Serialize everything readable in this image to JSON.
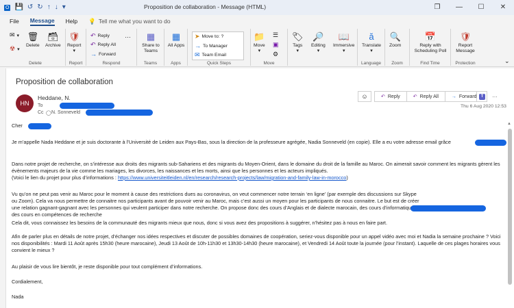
{
  "window": {
    "title": "Proposition de collaboration  -  Message (HTML)",
    "controls": [
      "restore-icon",
      "minimize-icon",
      "maximize-icon",
      "close-icon"
    ]
  },
  "menu": {
    "file": "File",
    "message": "Message",
    "help": "Help",
    "tell_me": "Tell me what you want to do"
  },
  "ribbon": {
    "delete_group": {
      "label": "Delete",
      "delete": "Delete",
      "archive": "Archive"
    },
    "report_group": {
      "label": "Report",
      "report": "Report"
    },
    "respond_group": {
      "label": "Respond",
      "reply": "Reply",
      "reply_all": "Reply All",
      "forward": "Forward"
    },
    "teams_group": {
      "label": "Teams",
      "share": "Share to Teams"
    },
    "apps_group": {
      "label": "Apps",
      "all_apps": "All Apps"
    },
    "quick_steps": {
      "label": "Quick Steps",
      "items": [
        "Move to: ?",
        "To Manager",
        "Team Email"
      ]
    },
    "move_group": {
      "label": "Move",
      "move": "Move"
    },
    "tags": {
      "tags": "Tags",
      "editing": "Editing",
      "immersive": "Immersive"
    },
    "language_group": {
      "label": "Language",
      "translate": "Translate"
    },
    "zoom_group": {
      "label": "Zoom",
      "zoom": "Zoom"
    },
    "find_time_group": {
      "label": "Find Time",
      "reply_poll": "Reply with Scheduling Poll"
    },
    "protection_group": {
      "label": "Protection",
      "report_message": "Report Message"
    }
  },
  "message": {
    "subject": "Proposition de collaboration",
    "avatar_initials": "HN",
    "sender": "Heddane, N.",
    "to_label": "To",
    "cc_label": "Cc",
    "cc_name": "N. Sonneveld",
    "date": "Thu 6 Aug 2020 12:53",
    "actions": {
      "reply": "Reply",
      "reply_all": "Reply All",
      "forward": "Forward"
    },
    "body": {
      "greeting": "Cher",
      "p1": "Je m’appelle Nada Heddane et je suis doctorante à l’Université de Leiden aux Pays-Bas, sous la direction de la professeure agrégée, Nadia Sonneveld (en copie). Elle a eu votre adresse email grâce",
      "p2": "Dans notre projet de recherche, on s’intéresse aux droits des migrants sub-Sahariens et des migrants du Moyen-Orient, dans le domaine du droit de la famille au Maroc. On aimerait savoir comment les migrants gèrent les évènements majeurs de la vie comme les mariages, les divorces, les naissances et les morts, ainsi que les personnes et les acteurs impliqués.",
      "p2b": "(Voici le lien du projet pour plus d’informations : ",
      "link": "https://www.universiteitleiden.nl/en/research/research-projects/law/migration-and-family-law-in-morocco",
      "p2c": ")",
      "p3": "Vu qu’on ne peut pas venir au Maroc pour le moment à cause des restrictions dues au coronavirus, on veut commencer notre terrain ‘en ligne’ (par exemple des discussions sur Skype ou Zoom). Cela va nous permettre de connaitre nos participants avant de pouvoir venir au Maroc, mais c’est aussi un moyen pour les participants de nous connaitre. Le but est de créer une relation gagnant-gagnant avec les personnes qui veulent participer dans notre recherche. On propose donc des cours d’Anglais et de dialecte marocain, des cours d’informatique et des cours en compétences de recherche",
      "p4": "Cela dit, vous connaissez les besoins de la communauté des migrants mieux que nous, donc si vous avez des propositions à suggérer, n’hésitez pas à nous en faire part.",
      "p5": "Afin de parler plus en détails de notre projet, d’échanger nos idées respectives et discuter de possibles domaines de coopération, seriez-vous disponible pour un appel vidéo avec moi et Nadia la semaine prochaine ? Voici nos disponibilités : Mardi 11 Août après 15h30 (heure marocaine), Jeudi 13 Août de 10h-11h30 et 13h30-14h30 (heure marocaine), et Vendredi 14 Août toute la journée (pour l’instant). Laquelle de ces plages horaires vous convient le mieux ?",
      "p6": "Au plaisir de vous lire bientôt, je reste disponible pour tout complément d’informations.",
      "closing": "Cordialement,",
      "signature": "Nada"
    }
  },
  "colors": {
    "accent": "#1e4e8c",
    "avatar": "#8b1c2a",
    "redaction": "#1565e0",
    "link": "#1155cc"
  }
}
